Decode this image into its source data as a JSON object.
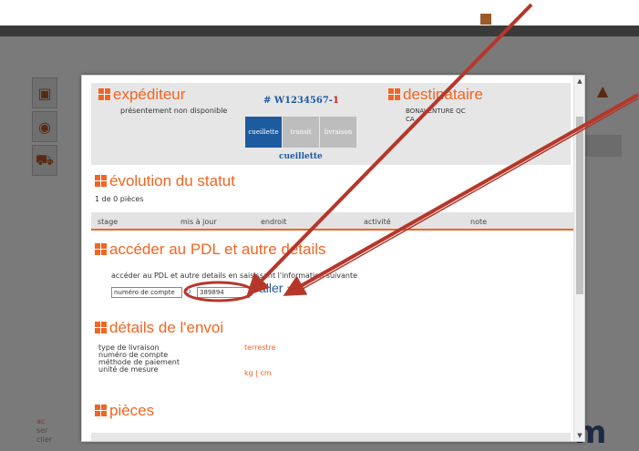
{
  "background": {
    "footer_lines": [
      "ac",
      "ser",
      "clier"
    ],
    "logo_text": "m"
  },
  "modal": {
    "sender": {
      "title": "expéditeur",
      "note": "présentement non disponible"
    },
    "waybill": {
      "prefix": "# W1234567-",
      "suffix": "1"
    },
    "status_buttons": [
      {
        "label": "cueillette",
        "color": "#1e5aa0"
      },
      {
        "label": "transit",
        "color": "#bdbdbd"
      },
      {
        "label": "livraison",
        "color": "#bdbdbd"
      }
    ],
    "current_status": "cueillette",
    "recipient": {
      "title": "destinataire",
      "line1": "BONAVENTURE QC",
      "line2": "CA"
    },
    "status_evolution": {
      "title": "évolution du statut",
      "pieces_count": "1 de 0 pièces",
      "columns": [
        "stage",
        "mis à jour",
        "endroit",
        "activité",
        "note"
      ]
    },
    "pod": {
      "title": "accéder au PDL et autre details",
      "instruction": "accéder au PDL et autre details en saisissant l'information suivante",
      "field_label": "numéro de compte",
      "field_value": "389894",
      "go_label": "aller"
    },
    "shipment_details": {
      "title": "détails de l'envoi",
      "rows": [
        {
          "label": "type de livraison",
          "value": "terrestre"
        },
        {
          "label": "numéro de compte",
          "value": ""
        },
        {
          "label": "méthode de paiement",
          "value": ""
        },
        {
          "label": "unité de mesure",
          "value": "kg | cm"
        }
      ]
    },
    "pieces": {
      "title": "pièces"
    }
  },
  "colors": {
    "accent": "#f26522",
    "link_blue": "#1e5aa0",
    "annotation_red": "#b5372a"
  },
  "icons": {
    "section": "orange-grid-icon",
    "refresh": "refresh-icon",
    "go": "chevron-right-icon"
  }
}
